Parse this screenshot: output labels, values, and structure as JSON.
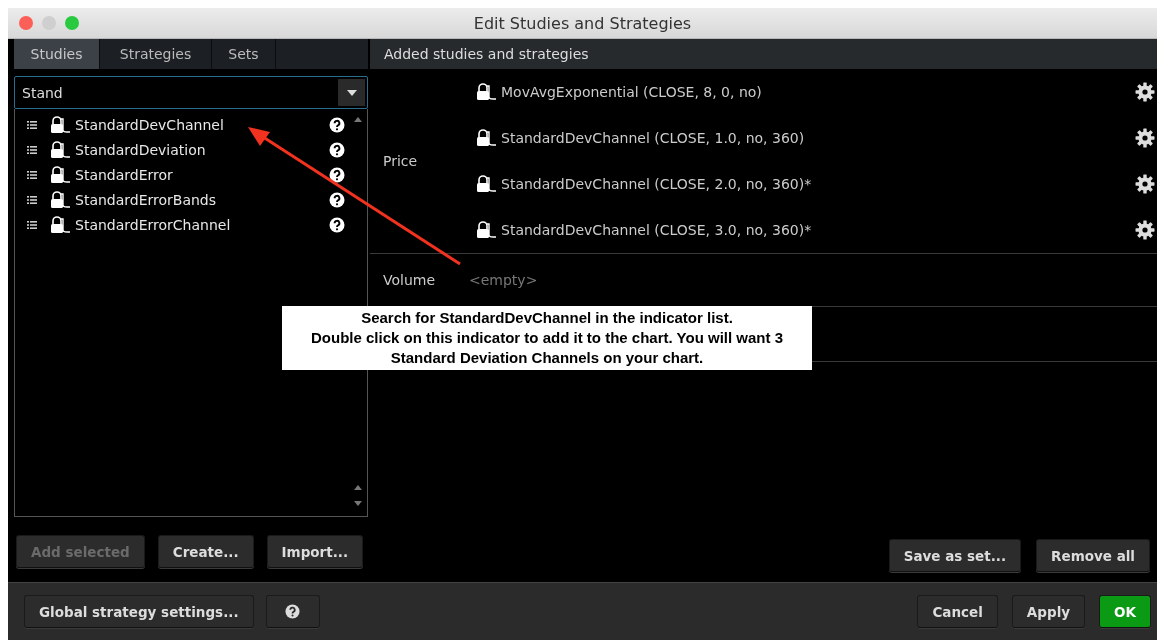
{
  "window": {
    "title": "Edit Studies and Strategies"
  },
  "tabs": [
    {
      "label": "Studies",
      "selected": true
    },
    {
      "label": "Strategies",
      "selected": false
    },
    {
      "label": "Sets",
      "selected": false
    }
  ],
  "search": {
    "value": "Stand"
  },
  "studies": [
    {
      "name": "StandardDevChannel"
    },
    {
      "name": "StandardDeviation"
    },
    {
      "name": "StandardError"
    },
    {
      "name": "StandardErrorBands"
    },
    {
      "name": "StandardErrorChannel"
    }
  ],
  "left_buttons": [
    {
      "label": "Add selected",
      "disabled": true
    },
    {
      "label": "Create...",
      "disabled": false
    },
    {
      "label": "Import...",
      "disabled": false
    }
  ],
  "added": {
    "header": "Added studies and strategies",
    "groups": [
      {
        "label": "Price",
        "studies": [
          "MovAvgExponential (CLOSE, 8, 0, no)",
          "StandardDevChannel (CLOSE, 1.0, no, 360)",
          "StandardDevChannel (CLOSE, 2.0, no, 360)*",
          "StandardDevChannel (CLOSE, 3.0, no, 360)*"
        ]
      },
      {
        "label": "Volume",
        "note": "<empty>"
      }
    ]
  },
  "right_buttons": [
    {
      "label": "Save as set..."
    },
    {
      "label": "Remove all"
    }
  ],
  "footer": {
    "left_buttons": [
      {
        "label": "Global strategy settings..."
      }
    ],
    "right_buttons": [
      {
        "label": "Cancel",
        "primary": false
      },
      {
        "label": "Apply",
        "primary": false
      },
      {
        "label": "OK",
        "primary": true
      }
    ]
  },
  "callout": {
    "lines": [
      "Search for StandardDevChannel in the indicator list.",
      "Double click on this indicator to add it to the chart. You will want 3",
      "Standard Deviation Channels on your chart."
    ]
  }
}
